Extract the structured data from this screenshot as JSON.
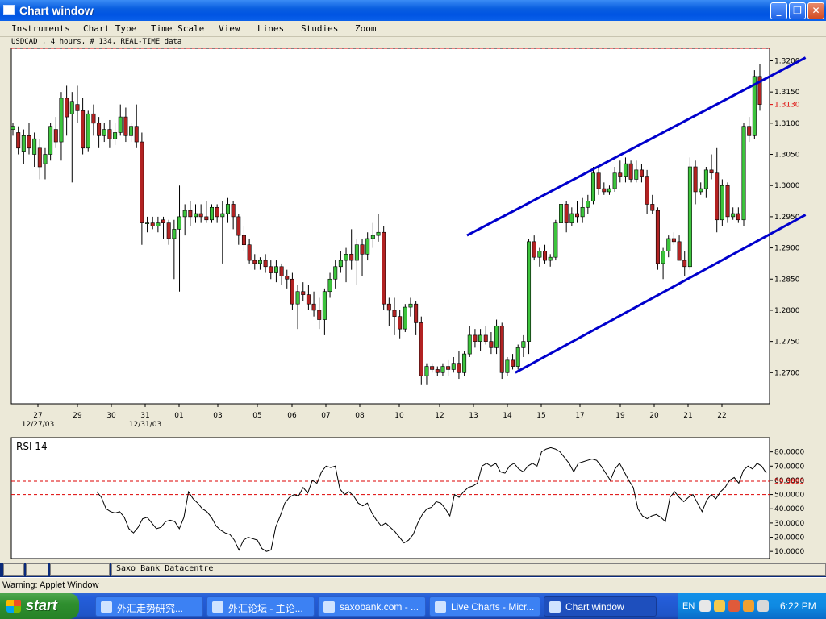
{
  "window": {
    "title": "Chart window",
    "minimize_icon": "minimize-icon",
    "restore_icon": "restore-icon",
    "close_icon": "close-icon"
  },
  "menu": [
    "Instruments",
    "Chart Type",
    "Time Scale",
    "View",
    "Lines",
    "Studies",
    "Zoom"
  ],
  "chart_info": "USDCAD , 4 hours, # 134, REAL-TIME data",
  "chart_data": [
    {
      "type": "candlestick",
      "instrument": "USDCAD",
      "ylim": [
        1.265,
        1.322
      ],
      "y_ticks": [
        "1.3200",
        "1.3150",
        "1.3100",
        "1.3050",
        "1.3000",
        "1.2950",
        "1.2900",
        "1.2850",
        "1.2800",
        "1.2750",
        "1.2700"
      ],
      "y_tick_values": [
        1.32,
        1.315,
        1.31,
        1.305,
        1.3,
        1.295,
        1.29,
        1.285,
        1.28,
        1.275,
        1.27
      ],
      "current_price_label": "1.3130",
      "current_price": 1.313,
      "top_reference_line": 1.322,
      "x_ticks": [
        "27",
        "29",
        "30",
        "31",
        "01",
        "03",
        "05",
        "06",
        "07",
        "08",
        "10",
        "12",
        "13",
        "14",
        "15",
        "17",
        "19",
        "20",
        "21",
        "22"
      ],
      "x_sublabels": [
        "12/27/03",
        "12/31/03"
      ],
      "candles": [
        [
          1.309,
          1.31,
          1.308,
          1.3095
        ],
        [
          1.3085,
          1.3095,
          1.305,
          1.306
        ],
        [
          1.3055,
          1.309,
          1.3035,
          1.308
        ],
        [
          1.308,
          1.31,
          1.305,
          1.306
        ],
        [
          1.305,
          1.3085,
          1.303,
          1.3075
        ],
        [
          1.306,
          1.3075,
          1.301,
          1.303
        ],
        [
          1.3035,
          1.306,
          1.301,
          1.305
        ],
        [
          1.305,
          1.31,
          1.304,
          1.3095
        ],
        [
          1.309,
          1.311,
          1.306,
          1.307
        ],
        [
          1.307,
          1.315,
          1.304,
          1.314
        ],
        [
          1.314,
          1.316,
          1.308,
          1.311
        ],
        [
          1.3115,
          1.315,
          1.3005,
          1.3135
        ],
        [
          1.313,
          1.316,
          1.31,
          1.312
        ],
        [
          1.312,
          1.314,
          1.305,
          1.306
        ],
        [
          1.306,
          1.312,
          1.3055,
          1.3115
        ],
        [
          1.3115,
          1.313,
          1.308,
          1.31
        ],
        [
          1.31,
          1.311,
          1.306,
          1.308
        ],
        [
          1.308,
          1.31,
          1.307,
          1.309
        ],
        [
          1.309,
          1.3105,
          1.306,
          1.3075
        ],
        [
          1.3075,
          1.31,
          1.3065,
          1.3085
        ],
        [
          1.3085,
          1.313,
          1.308,
          1.311
        ],
        [
          1.311,
          1.3125,
          1.307,
          1.308
        ],
        [
          1.308,
          1.31,
          1.307,
          1.3095
        ],
        [
          1.3095,
          1.313,
          1.306,
          1.307
        ],
        [
          1.307,
          1.3085,
          1.2905,
          1.294
        ],
        [
          1.294,
          1.295,
          1.2925,
          1.294
        ],
        [
          1.294,
          1.295,
          1.293,
          1.2935
        ],
        [
          1.2935,
          1.295,
          1.2925,
          1.294
        ],
        [
          1.2945,
          1.295,
          1.2915,
          1.294
        ],
        [
          1.294,
          1.2945,
          1.2905,
          1.2915
        ],
        [
          1.2915,
          1.2945,
          1.285,
          1.293
        ],
        [
          1.293,
          1.3,
          1.283,
          1.295
        ],
        [
          1.295,
          1.297,
          1.292,
          1.296
        ],
        [
          1.296,
          1.2975,
          1.2935,
          1.295
        ],
        [
          1.295,
          1.297,
          1.294,
          1.2955
        ],
        [
          1.2955,
          1.297,
          1.294,
          1.295
        ],
        [
          1.295,
          1.2975,
          1.294,
          1.2945
        ],
        [
          1.2945,
          1.297,
          1.294,
          1.2965
        ],
        [
          1.2965,
          1.297,
          1.294,
          1.295
        ],
        [
          1.295,
          1.2975,
          1.2875,
          1.2955
        ],
        [
          1.2955,
          1.298,
          1.294,
          1.297
        ],
        [
          1.297,
          1.2975,
          1.293,
          1.295
        ],
        [
          1.295,
          1.2955,
          1.2905,
          1.292
        ],
        [
          1.292,
          1.2935,
          1.2895,
          1.2905
        ],
        [
          1.2905,
          1.2915,
          1.2875,
          1.288
        ],
        [
          1.288,
          1.289,
          1.2865,
          1.2875
        ],
        [
          1.2875,
          1.2885,
          1.2865,
          1.288
        ],
        [
          1.288,
          1.289,
          1.286,
          1.287
        ],
        [
          1.287,
          1.288,
          1.285,
          1.286
        ],
        [
          1.286,
          1.288,
          1.2845,
          1.287
        ],
        [
          1.287,
          1.2875,
          1.284,
          1.2855
        ],
        [
          1.2855,
          1.2865,
          1.2835,
          1.285
        ],
        [
          1.285,
          1.286,
          1.28,
          1.281
        ],
        [
          1.281,
          1.284,
          1.277,
          1.283
        ],
        [
          1.283,
          1.2845,
          1.2815,
          1.2825
        ],
        [
          1.2825,
          1.284,
          1.28,
          1.281
        ],
        [
          1.281,
          1.283,
          1.279,
          1.28
        ],
        [
          1.28,
          1.282,
          1.277,
          1.2785
        ],
        [
          1.2785,
          1.2835,
          1.276,
          1.283
        ],
        [
          1.283,
          1.286,
          1.282,
          1.285
        ],
        [
          1.285,
          1.288,
          1.2835,
          1.287
        ],
        [
          1.287,
          1.2895,
          1.286,
          1.288
        ],
        [
          1.288,
          1.29,
          1.2845,
          1.289
        ],
        [
          1.289,
          1.293,
          1.2865,
          1.288
        ],
        [
          1.288,
          1.2915,
          1.284,
          1.2905
        ],
        [
          1.2905,
          1.2915,
          1.2855,
          1.289
        ],
        [
          1.289,
          1.2925,
          1.288,
          1.2915
        ],
        [
          1.2915,
          1.294,
          1.29,
          1.292
        ],
        [
          1.292,
          1.2955,
          1.291,
          1.2925
        ],
        [
          1.2925,
          1.2935,
          1.28,
          1.281
        ],
        [
          1.281,
          1.282,
          1.2775,
          1.28
        ],
        [
          1.28,
          1.282,
          1.276,
          1.279
        ],
        [
          1.279,
          1.28,
          1.2755,
          1.277
        ],
        [
          1.277,
          1.281,
          1.2765,
          1.2805
        ],
        [
          1.2805,
          1.282,
          1.279,
          1.281
        ],
        [
          1.281,
          1.2815,
          1.276,
          1.278
        ],
        [
          1.278,
          1.279,
          1.268,
          1.2695
        ],
        [
          1.2695,
          1.2715,
          1.268,
          1.271
        ],
        [
          1.271,
          1.2715,
          1.27,
          1.2705
        ],
        [
          1.2705,
          1.271,
          1.2695,
          1.27
        ],
        [
          1.27,
          1.2715,
          1.2695,
          1.271
        ],
        [
          1.271,
          1.272,
          1.2695,
          1.2705
        ],
        [
          1.2705,
          1.2725,
          1.27,
          1.2715
        ],
        [
          1.2715,
          1.2735,
          1.269,
          1.27
        ],
        [
          1.27,
          1.2735,
          1.2695,
          1.273
        ],
        [
          1.273,
          1.2775,
          1.2725,
          1.276
        ],
        [
          1.276,
          1.277,
          1.274,
          1.275
        ],
        [
          1.275,
          1.277,
          1.2735,
          1.276
        ],
        [
          1.276,
          1.2775,
          1.2745,
          1.275
        ],
        [
          1.275,
          1.2765,
          1.273,
          1.274
        ],
        [
          1.274,
          1.2785,
          1.273,
          1.2775
        ],
        [
          1.2775,
          1.278,
          1.269,
          1.27
        ],
        [
          1.27,
          1.2725,
          1.2695,
          1.272
        ],
        [
          1.272,
          1.273,
          1.2705,
          1.271
        ],
        [
          1.271,
          1.2745,
          1.2705,
          1.274
        ],
        [
          1.274,
          1.276,
          1.2725,
          1.275
        ],
        [
          1.275,
          1.2915,
          1.273,
          1.291
        ],
        [
          1.291,
          1.292,
          1.288,
          1.2885
        ],
        [
          1.2885,
          1.29,
          1.287,
          1.2895
        ],
        [
          1.2895,
          1.2905,
          1.2875,
          1.288
        ],
        [
          1.288,
          1.289,
          1.287,
          1.2885
        ],
        [
          1.2885,
          1.2945,
          1.288,
          1.294
        ],
        [
          1.294,
          1.2985,
          1.2935,
          1.297
        ],
        [
          1.297,
          1.2975,
          1.2925,
          1.294
        ],
        [
          1.294,
          1.2965,
          1.2935,
          1.2955
        ],
        [
          1.2955,
          1.2975,
          1.294,
          1.295
        ],
        [
          1.295,
          1.298,
          1.294,
          1.2965
        ],
        [
          1.2965,
          1.2985,
          1.2955,
          1.2975
        ],
        [
          1.2975,
          1.303,
          1.297,
          1.302
        ],
        [
          1.302,
          1.303,
          1.2985,
          1.2995
        ],
        [
          1.2995,
          1.3005,
          1.2985,
          1.299
        ],
        [
          1.299,
          1.3,
          1.2985,
          1.2995
        ],
        [
          1.2995,
          1.303,
          1.299,
          1.302
        ],
        [
          1.302,
          1.304,
          1.3005,
          1.3015
        ],
        [
          1.3015,
          1.3045,
          1.3005,
          1.3035
        ],
        [
          1.3035,
          1.304,
          1.3005,
          1.301
        ],
        [
          1.301,
          1.304,
          1.3005,
          1.3025
        ],
        [
          1.3025,
          1.3035,
          1.3005,
          1.3015
        ],
        [
          1.3015,
          1.3025,
          1.2955,
          1.297
        ],
        [
          1.297,
          1.2985,
          1.2955,
          1.296
        ],
        [
          1.296,
          1.2965,
          1.2865,
          1.2875
        ],
        [
          1.2875,
          1.29,
          1.285,
          1.2895
        ],
        [
          1.2895,
          1.292,
          1.2885,
          1.2915
        ],
        [
          1.2915,
          1.2925,
          1.2905,
          1.291
        ],
        [
          1.291,
          1.292,
          1.2885,
          1.288
        ],
        [
          1.288,
          1.2895,
          1.2855,
          1.287
        ],
        [
          1.287,
          1.3045,
          1.2865,
          1.303
        ],
        [
          1.303,
          1.304,
          1.297,
          1.299
        ],
        [
          1.299,
          1.3005,
          1.2985,
          1.2995
        ],
        [
          1.2995,
          1.303,
          1.298,
          1.3025
        ],
        [
          1.3025,
          1.305,
          1.301,
          1.302
        ],
        [
          1.302,
          1.306,
          1.2925,
          1.2945
        ],
        [
          1.2945,
          1.301,
          1.2935,
          1.3
        ],
        [
          1.3,
          1.3005,
          1.294,
          1.295
        ],
        [
          1.295,
          1.2965,
          1.2945,
          1.2955
        ],
        [
          1.2955,
          1.2965,
          1.294,
          1.2945
        ],
        [
          1.2945,
          1.31,
          1.2935,
          1.3095
        ],
        [
          1.3095,
          1.311,
          1.307,
          1.308
        ],
        [
          1.308,
          1.3185,
          1.3075,
          1.3175
        ],
        [
          1.3175,
          1.3195,
          1.312,
          1.313
        ]
      ]
    },
    {
      "type": "line",
      "title": "RSI 14",
      "ylim": [
        5,
        90
      ],
      "y_ticks": [
        "80.0000",
        "70.0000",
        "60.0000",
        "50.0000",
        "40.0000",
        "30.0000",
        "20.0000",
        "10.0000"
      ],
      "y_tick_values": [
        80,
        70,
        60,
        50,
        40,
        30,
        20,
        10
      ],
      "reference_lines": [
        59.3695,
        50
      ],
      "current_value_label": "59.3695",
      "values": [
        52,
        48,
        40,
        38,
        37,
        38,
        34,
        26,
        23,
        27,
        33,
        34,
        30,
        26,
        27,
        31,
        32,
        31,
        26,
        34,
        52,
        47,
        44,
        40,
        38,
        34,
        28,
        25,
        23,
        22,
        18,
        11,
        18,
        20,
        19,
        18,
        12,
        10,
        11,
        27,
        35,
        44,
        48,
        50,
        49,
        55,
        51,
        60,
        58,
        66,
        70,
        69,
        70,
        54,
        50,
        52,
        49,
        44,
        42,
        44,
        37,
        32,
        28,
        30,
        27,
        24,
        20,
        16,
        18,
        22,
        30,
        36,
        40,
        41,
        45,
        44,
        40,
        35,
        50,
        48,
        52,
        55,
        56,
        58,
        70,
        72,
        70,
        72,
        66,
        65,
        70,
        72,
        68,
        66,
        70,
        72,
        70,
        80,
        82,
        83,
        82,
        80,
        76,
        72,
        66,
        72,
        73,
        74,
        75,
        74,
        70,
        65,
        60,
        68,
        72,
        66,
        60,
        55,
        40,
        35,
        33,
        35,
        36,
        34,
        31,
        48,
        52,
        48,
        45,
        48,
        50,
        44,
        38,
        46,
        50,
        47,
        52,
        55,
        60,
        62,
        58,
        67,
        70,
        68,
        72,
        70,
        65
      ]
    }
  ],
  "statusbar": {
    "text": "Saxo Bank Datacentre"
  },
  "warning": "Warning: Applet Window",
  "taskbar": {
    "start_label": "start",
    "tasks": [
      "外汇走势研究...",
      "外汇论坛 - 主论...",
      "saxobank.com - ...",
      "Live Charts - Micr...",
      "Chart window"
    ],
    "language": "EN",
    "clock": "6:22 PM"
  },
  "colors": {
    "bull": "#3cc43c",
    "bear": "#b22222",
    "channel": "#0000cc",
    "ref": "#dd0000"
  }
}
